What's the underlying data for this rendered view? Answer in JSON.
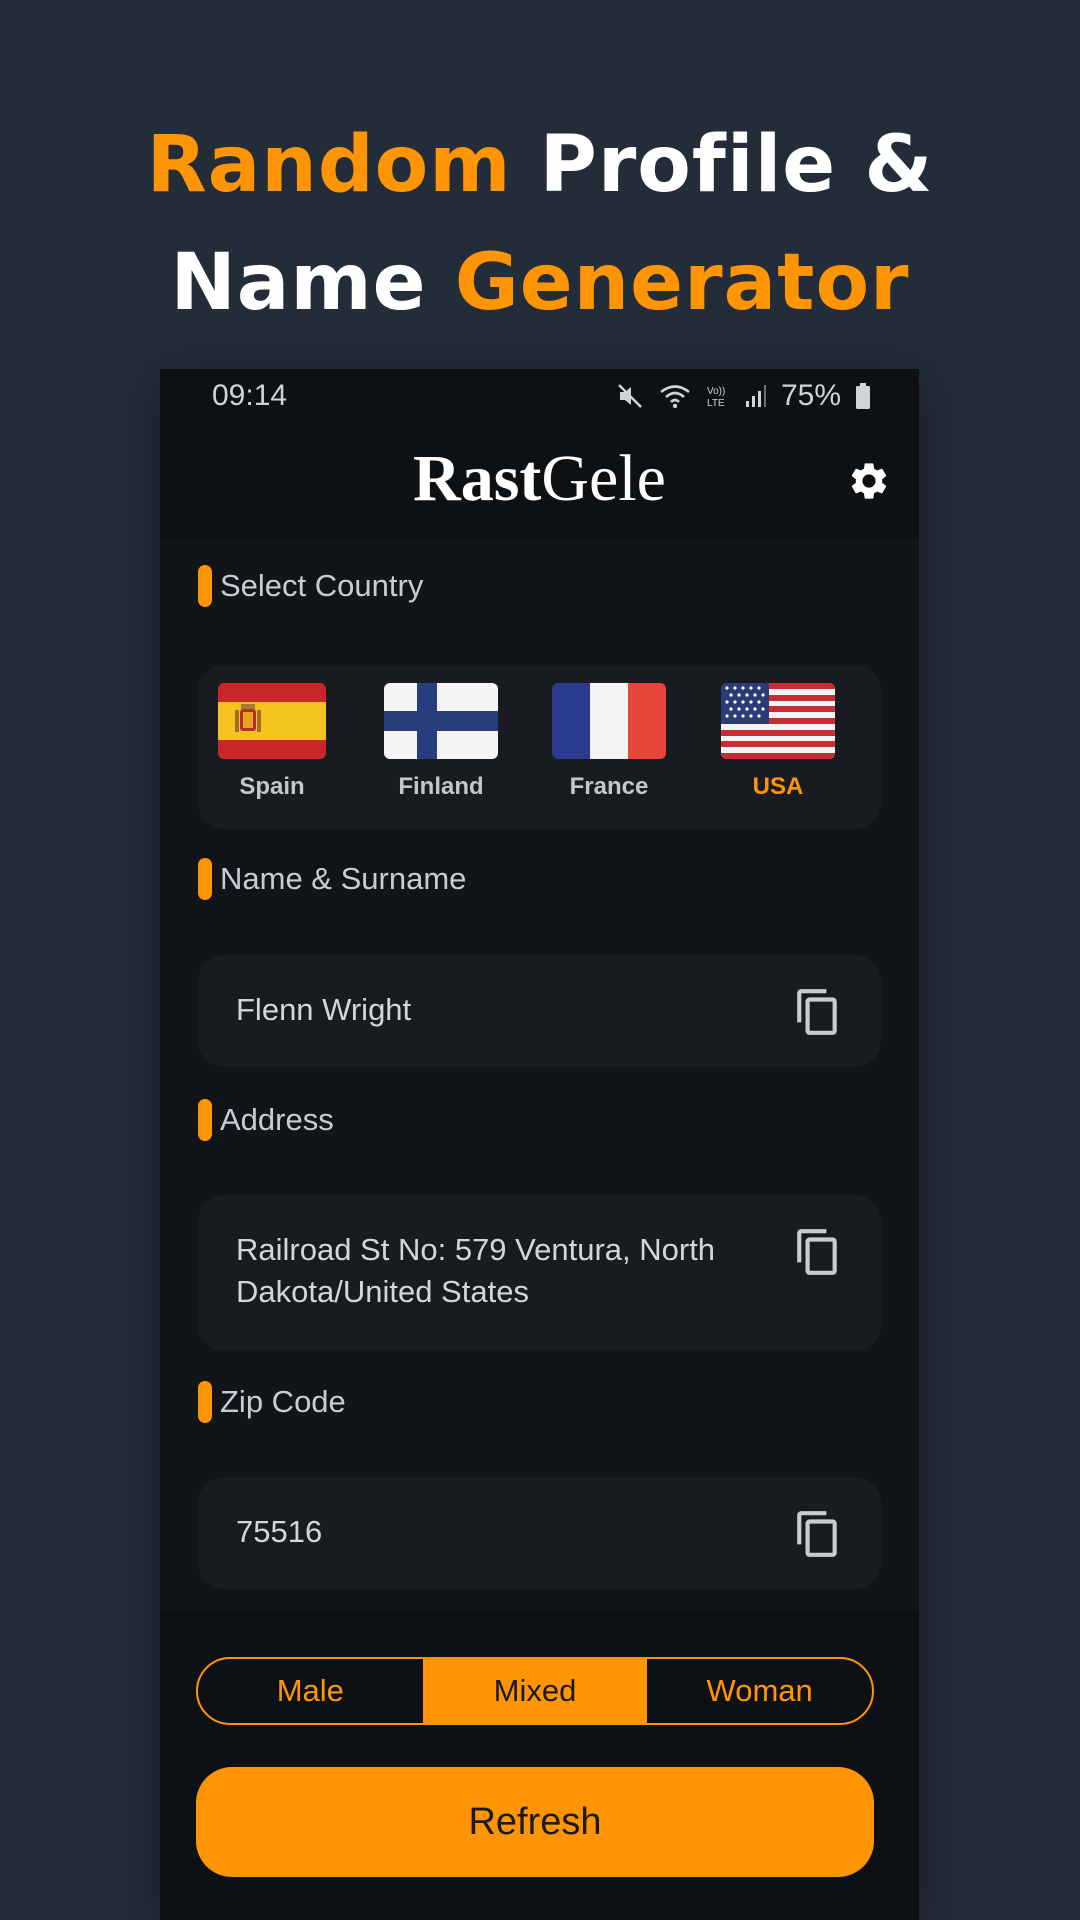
{
  "headline": {
    "line1_accent": "Random",
    "line1_rest": " Profile &",
    "line2_start": "Name ",
    "line2_accent": "Generator"
  },
  "status_bar": {
    "time": "09:14",
    "battery": "75%",
    "icons": [
      "mute-icon",
      "wifi-icon",
      "volte-icon",
      "signal-icon",
      "battery-icon"
    ]
  },
  "app": {
    "logo_bold": "Rast",
    "logo_light": "Gele"
  },
  "select_country": {
    "label": "Select Country",
    "countries": [
      {
        "name": "Spain",
        "selected": false
      },
      {
        "name": "Finland",
        "selected": false
      },
      {
        "name": "France",
        "selected": false
      },
      {
        "name": "USA",
        "selected": true
      }
    ]
  },
  "name_field": {
    "label": "Name & Surname",
    "value": "Flenn Wright"
  },
  "address_field": {
    "label": "Address",
    "value": "Railroad St No: 579 Ventura, North Dakota/United States"
  },
  "zip_field": {
    "label": "Zip Code",
    "value": "75516"
  },
  "gender": {
    "options": [
      "Male",
      "Mixed",
      "Woman"
    ],
    "selected": "Mixed"
  },
  "refresh_label": "Refresh",
  "colors": {
    "accent": "#ff9505",
    "background": "#232d39",
    "surface": "#111418",
    "card": "#181c21"
  }
}
